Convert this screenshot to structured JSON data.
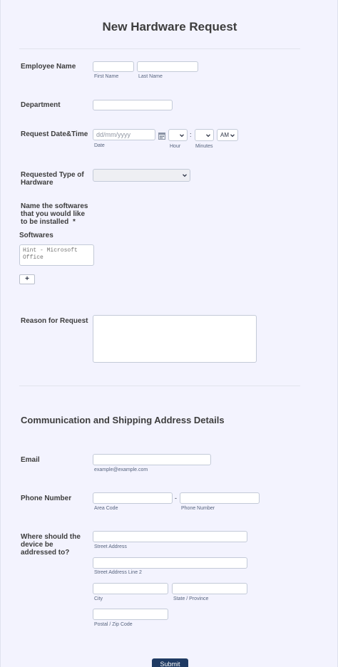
{
  "form": {
    "title": "New Hardware Request",
    "required_mark": "*"
  },
  "employee_name": {
    "label": "Employee Name",
    "first_sublabel": "First Name",
    "last_sublabel": "Last Name",
    "first_value": "",
    "last_value": ""
  },
  "department": {
    "label": "Department",
    "value": ""
  },
  "request_datetime": {
    "label": "Request Date&Time",
    "date_placeholder": "dd/mm/yyyy",
    "date_sublabel": "Date",
    "hour_sublabel": "Hour",
    "minutes_sublabel": "Minutes",
    "hour_value": "",
    "minutes_value": "",
    "time_separator": ":",
    "ampm_value": "AM",
    "calendar_icon": "calendar-icon"
  },
  "hardware_type": {
    "label": "Requested Type of Hardware",
    "selected": ""
  },
  "softwares": {
    "question": "Name the softwares that you would like to be installed",
    "column_header": "Softwares",
    "placeholder": "Hint - Microsoft Office",
    "add_label": "+"
  },
  "reason": {
    "label": "Reason for Request",
    "value": ""
  },
  "shipping_section": {
    "heading": "Communication and Shipping Address Details"
  },
  "email": {
    "label": "Email",
    "sublabel": "example@example.com",
    "value": ""
  },
  "phone": {
    "label": "Phone Number",
    "area_sublabel": "Area Code",
    "number_sublabel": "Phone Number",
    "dash": "-"
  },
  "address": {
    "label": "Where should the device be addressed to?",
    "street_sublabel": "Street Address",
    "street2_sublabel": "Street Address Line 2",
    "city_sublabel": "City",
    "state_sublabel": "State / Province",
    "zip_sublabel": "Postal / Zip Code"
  },
  "submit": {
    "label": "Submit"
  },
  "colors": {
    "background": "#f3f3fe",
    "submit_button": "#1f3a63",
    "field_border": "#c3cad8",
    "label_text": "#3d3d3d"
  }
}
